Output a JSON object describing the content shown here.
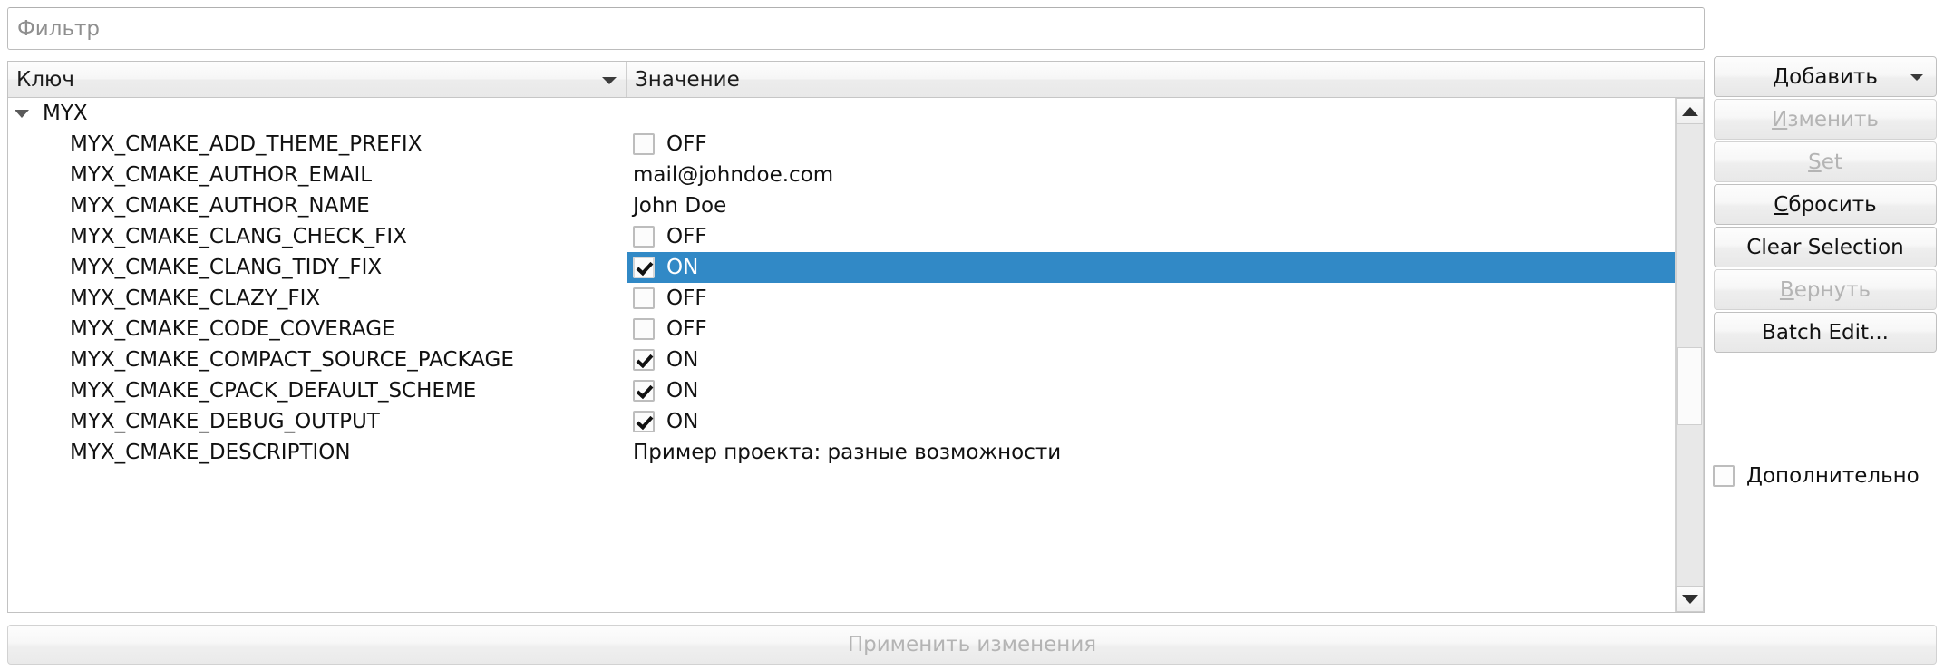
{
  "filter": {
    "value": "",
    "placeholder": "Фильтр"
  },
  "tree": {
    "columns": {
      "key": "Ключ",
      "value": "Значение"
    },
    "sort_indicator": "chevron-down-icon",
    "rows": [
      {
        "key": "MYX",
        "level": 0,
        "expanded": true,
        "value_type": "none",
        "value": "",
        "selected": false
      },
      {
        "key": "MYX_CMAKE_ADD_THEME_PREFIX",
        "level": 1,
        "expanded": false,
        "value_type": "checkbox",
        "value": "OFF",
        "checked": false,
        "selected": false
      },
      {
        "key": "MYX_CMAKE_AUTHOR_EMAIL",
        "level": 1,
        "expanded": false,
        "value_type": "text",
        "value": "mail@johndoe.com",
        "selected": false
      },
      {
        "key": "MYX_CMAKE_AUTHOR_NAME",
        "level": 1,
        "expanded": false,
        "value_type": "text",
        "value": "John Doe",
        "selected": false
      },
      {
        "key": "MYX_CMAKE_CLANG_CHECK_FIX",
        "level": 1,
        "expanded": false,
        "value_type": "checkbox",
        "value": "OFF",
        "checked": false,
        "selected": false
      },
      {
        "key": "MYX_CMAKE_CLANG_TIDY_FIX",
        "level": 1,
        "expanded": false,
        "value_type": "checkbox",
        "value": "ON",
        "checked": true,
        "selected": true
      },
      {
        "key": "MYX_CMAKE_CLAZY_FIX",
        "level": 1,
        "expanded": false,
        "value_type": "checkbox",
        "value": "OFF",
        "checked": false,
        "selected": false
      },
      {
        "key": "MYX_CMAKE_CODE_COVERAGE",
        "level": 1,
        "expanded": false,
        "value_type": "checkbox",
        "value": "OFF",
        "checked": false,
        "selected": false
      },
      {
        "key": "MYX_CMAKE_COMPACT_SOURCE_PACKAGE",
        "level": 1,
        "expanded": false,
        "value_type": "checkbox",
        "value": "ON",
        "checked": true,
        "selected": false
      },
      {
        "key": "MYX_CMAKE_CPACK_DEFAULT_SCHEME",
        "level": 1,
        "expanded": false,
        "value_type": "checkbox",
        "value": "ON",
        "checked": true,
        "selected": false
      },
      {
        "key": "MYX_CMAKE_DEBUG_OUTPUT",
        "level": 1,
        "expanded": false,
        "value_type": "checkbox",
        "value": "ON",
        "checked": true,
        "selected": false
      },
      {
        "key": "MYX_CMAKE_DESCRIPTION",
        "level": 1,
        "expanded": false,
        "value_type": "text",
        "value": "Пример проекта: разные возможности",
        "selected": false
      }
    ],
    "scrollbar": {
      "up_arrow": "scroll-up-arrow-icon",
      "down_arrow": "scroll-down-arrow-icon"
    }
  },
  "buttons": {
    "add": {
      "label": "Добавить",
      "mnemonic": "Д",
      "disabled": false,
      "has_menu": true
    },
    "edit": {
      "label": "Изменить",
      "mnemonic": "И",
      "disabled": true,
      "has_menu": false
    },
    "set": {
      "label": "Set",
      "mnemonic": "S",
      "disabled": true,
      "has_menu": false
    },
    "reset": {
      "label": "Сбросить",
      "mnemonic": "С",
      "disabled": false,
      "has_menu": false
    },
    "clear_selection": {
      "label": "Clear Selection",
      "mnemonic": "",
      "disabled": false,
      "has_menu": false
    },
    "revert": {
      "label": "Вернуть",
      "mnemonic": "В",
      "disabled": true,
      "has_menu": false
    },
    "batch_edit": {
      "label": "Batch Edit...",
      "mnemonic": "",
      "disabled": false,
      "has_menu": false
    }
  },
  "advanced_checkbox": {
    "label": "Дополнительно",
    "checked": false
  },
  "apply": {
    "label": "Применить изменения",
    "disabled": true
  },
  "colors": {
    "selection_blue": "#3189c6",
    "selection_text": "#ffffff",
    "panel_bg": "#ffffff",
    "disabled_text": "#b4b4b4",
    "placeholder_text": "#8f8f8f"
  }
}
